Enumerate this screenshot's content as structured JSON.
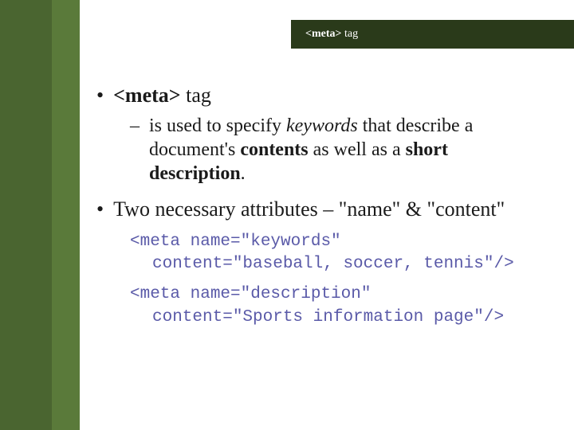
{
  "header": {
    "tag_bold": "<meta>",
    "tag_suffix": " tag"
  },
  "content": {
    "item1": {
      "tag_bold": "<meta>",
      "tag_suffix": " tag",
      "sub": {
        "pre": "is used to specify ",
        "keywords": "keywords",
        "mid1": " that describe a document's ",
        "contents": "contents",
        "mid2": " as well as a ",
        "shortdesc": "short description",
        "end": "."
      }
    },
    "item2": {
      "text": "Two necessary attributes – \"name\" & \"content\""
    },
    "code1": {
      "line1": "<meta name=\"keywords\"",
      "line2": "content=\"baseball, soccer, tennis\"/>"
    },
    "code2": {
      "line1": "<meta name=\"description\"",
      "line2": "content=\"Sports information page\"/>"
    }
  }
}
